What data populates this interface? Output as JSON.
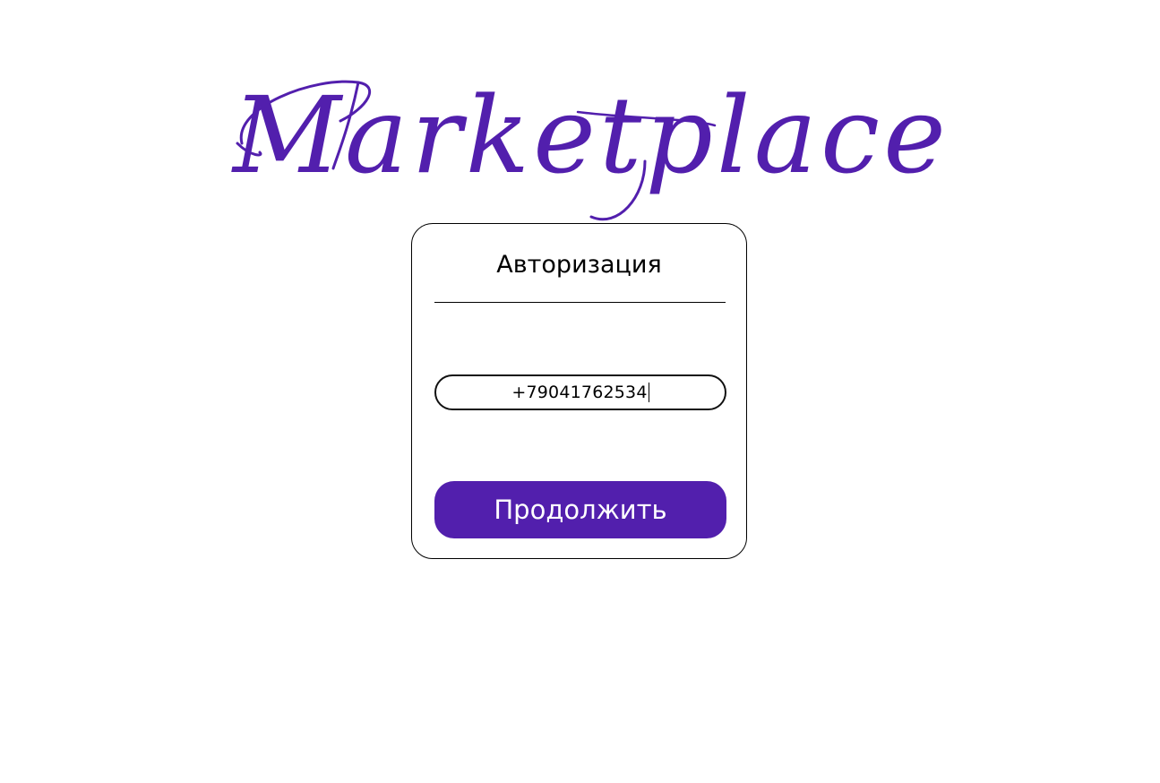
{
  "logo": {
    "text": "Marketplace"
  },
  "auth": {
    "title": "Авторизация",
    "phone_value": "+79041762534",
    "continue_label": "Продолжить"
  },
  "colors": {
    "brand": "#521fad",
    "border": "#000000",
    "background": "#ffffff"
  }
}
